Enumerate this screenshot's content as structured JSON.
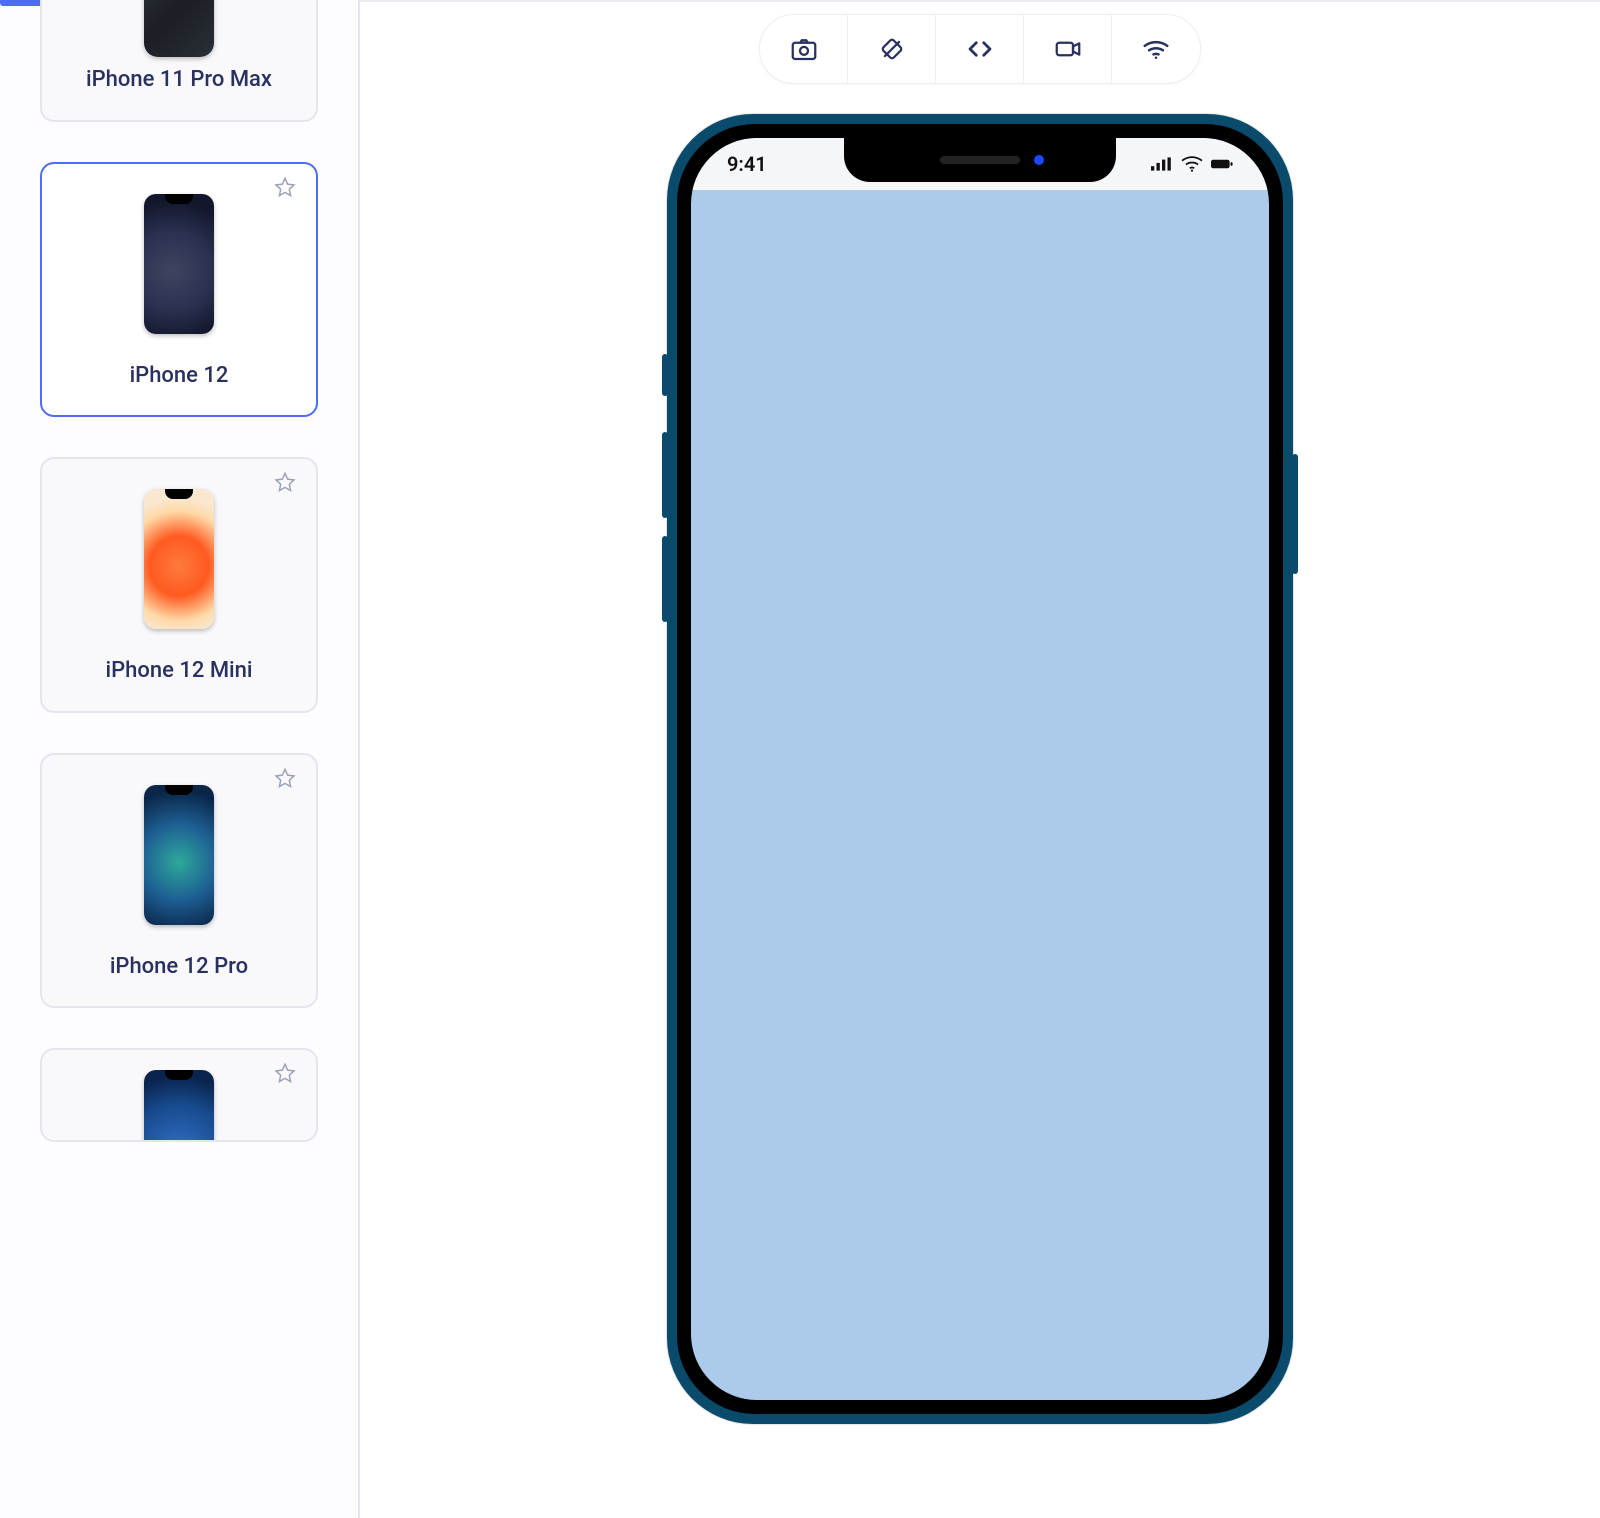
{
  "sidebar": {
    "devices": [
      {
        "label": "iPhone 11 Pro Max",
        "selected": false,
        "thumb": "thumb-11promax"
      },
      {
        "label": "iPhone 12",
        "selected": true,
        "thumb": "thumb-12"
      },
      {
        "label": "iPhone 12 Mini",
        "selected": false,
        "thumb": "thumb-12mini"
      },
      {
        "label": "iPhone 12 Pro",
        "selected": false,
        "thumb": "thumb-12pro"
      },
      {
        "label": "",
        "selected": false,
        "thumb": "thumb-partial"
      }
    ]
  },
  "toolbar": {
    "buttons": [
      {
        "name": "screenshot",
        "icon": "camera-icon"
      },
      {
        "name": "rotate",
        "icon": "rotate-icon"
      },
      {
        "name": "code",
        "icon": "code-icon"
      },
      {
        "name": "record",
        "icon": "video-icon"
      },
      {
        "name": "network",
        "icon": "wifi-icon"
      }
    ]
  },
  "preview": {
    "status_time": "9:41",
    "screen_color": "#accbeb",
    "frame_color": "#0a4a6a"
  }
}
